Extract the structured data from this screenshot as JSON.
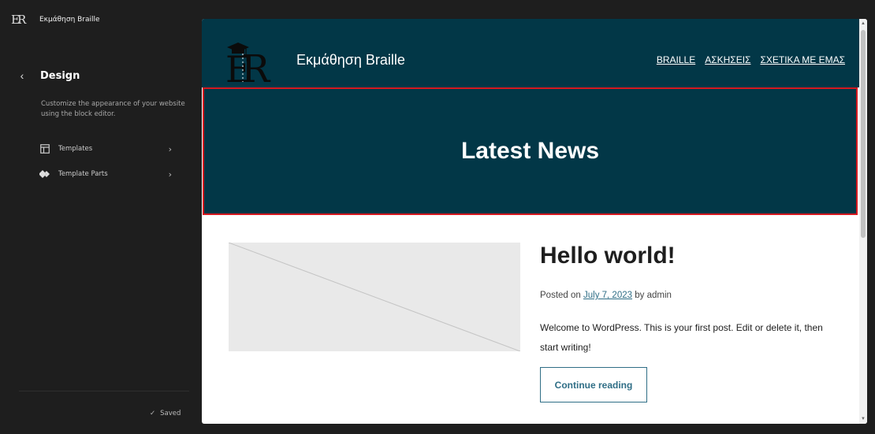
{
  "sidebar": {
    "site_name": "Εκμάθηση Braille",
    "design_title": "Design",
    "description": "Customize the appearance of your website using the block editor.",
    "nav_items": [
      {
        "label": "Templates",
        "icon": "layout-icon"
      },
      {
        "label": "Template Parts",
        "icon": "symbol-filled-icon"
      }
    ],
    "saved_label": "Saved"
  },
  "preview": {
    "brand": "Εκμάθηση Braille",
    "menu": [
      "BRAILLE",
      "ΑΣΚΗΣΕΙΣ",
      "ΣΧΕΤΙΚΑ ΜΕ ΕΜΑΣ"
    ],
    "cover_title": "Latest News",
    "post": {
      "title": "Hello world!",
      "meta_prefix": "Posted on",
      "date": "July 7, 2023",
      "meta_by": "by",
      "author": "admin",
      "excerpt": "Welcome to WordPress. This is your first post. Edit or delete it, then start writing!",
      "button": "Continue reading"
    }
  },
  "colors": {
    "header_bg": "#023747",
    "highlight_border": "#d5181f",
    "link": "#2f6e86",
    "sidebar_bg": "#1e1e1e"
  }
}
